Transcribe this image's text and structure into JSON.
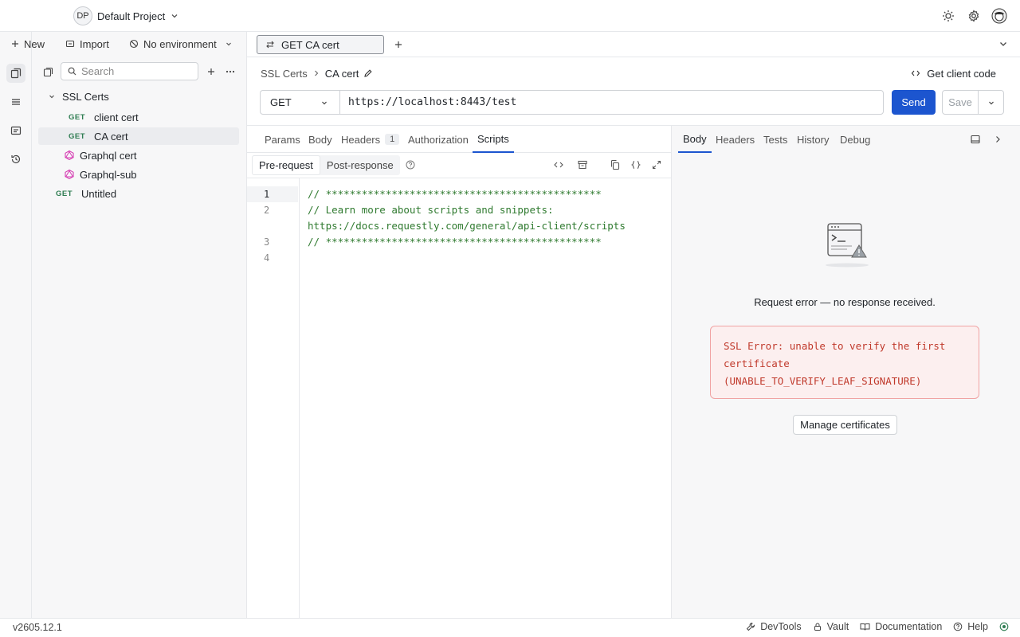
{
  "header": {
    "project_initials": "DP",
    "project_name": "Default Project"
  },
  "sidebar": {
    "new_label": "New",
    "import_label": "Import",
    "environment_label": "No environment",
    "search_placeholder": "Search",
    "items": [
      {
        "type": "folder",
        "label": "SSL Certs"
      },
      {
        "type": "request",
        "method": "GET",
        "label": "client cert"
      },
      {
        "type": "request",
        "method": "GET",
        "label": "CA cert"
      },
      {
        "type": "graphql",
        "label": "Graphql cert"
      },
      {
        "type": "graphql",
        "label": "Graphql-sub"
      },
      {
        "type": "request",
        "method": "GET",
        "label": "Untitled"
      }
    ]
  },
  "tabs": [
    {
      "label": "GET CA cert"
    }
  ],
  "breadcrumb": {
    "collection": "SSL Certs",
    "request": "CA cert"
  },
  "get_code_label": "Get client code",
  "request": {
    "method": "GET",
    "url": "https://localhost:8443/test",
    "send_label": "Send",
    "save_label": "Save"
  },
  "request_tabs": [
    {
      "label": "Params"
    },
    {
      "label": "Body"
    },
    {
      "label": "Headers",
      "count": "1"
    },
    {
      "label": "Authorization"
    },
    {
      "label": "Scripts"
    }
  ],
  "script_tabs": {
    "pre": "Pre-request",
    "post": "Post-response"
  },
  "editor": {
    "line_numbers": [
      "1",
      "2",
      "3",
      "4"
    ],
    "lines": [
      "// **********************************************",
      "// Learn more about scripts and snippets:",
      "https://docs.requestly.com/general/api-client/scripts",
      "// **********************************************"
    ]
  },
  "response_tabs": [
    {
      "label": "Body"
    },
    {
      "label": "Headers"
    },
    {
      "label": "Tests"
    },
    {
      "label": "History"
    },
    {
      "label": "Debug"
    }
  ],
  "response": {
    "error_title": "Request error — no response received.",
    "error_lines": [
      "SSL Error: unable to verify the first",
      "certificate",
      "(UNABLE_TO_VERIFY_LEAF_SIGNATURE)"
    ],
    "manage_label": "Manage certificates"
  },
  "statusbar": {
    "version": "v2605.12.1",
    "devtools": "DevTools",
    "vault": "Vault",
    "documentation": "Documentation",
    "help": "Help"
  },
  "colors": {
    "accent": "#1c55cf",
    "method_get": "#2f7d52",
    "graphql": "#d63fb3",
    "error_text": "#c0392b",
    "error_bg": "#fcefef",
    "code_comment": "#2f7a2f"
  }
}
